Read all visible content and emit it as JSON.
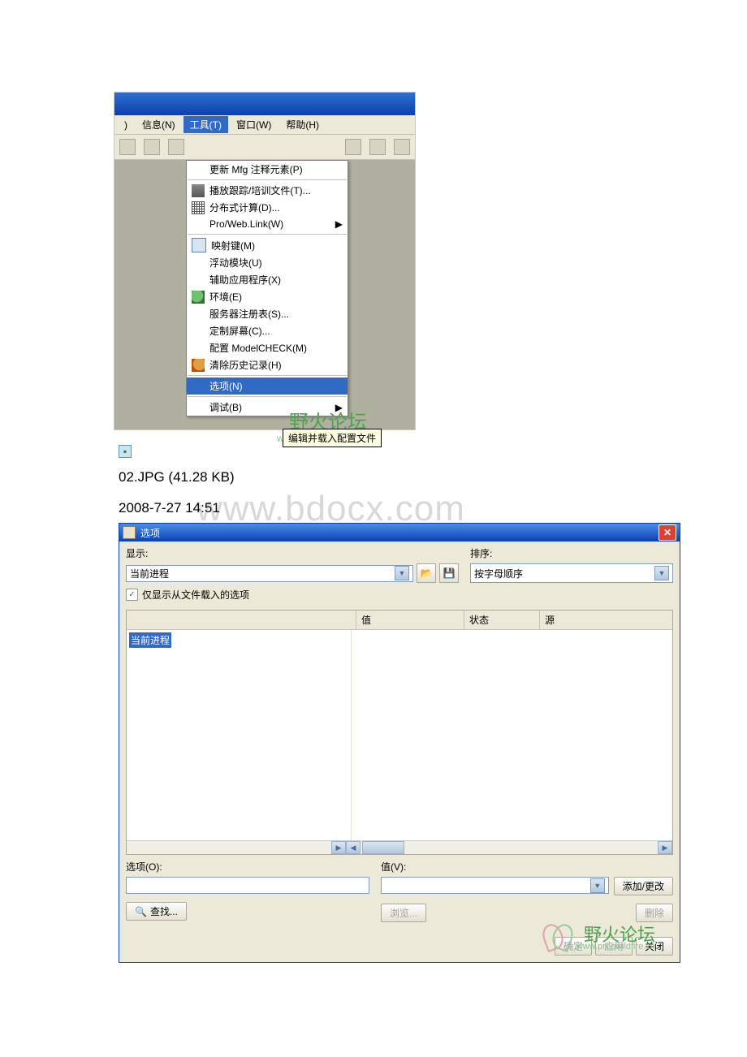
{
  "shot1": {
    "menubar": {
      "info": "信息(N)",
      "tools": "工具(T)",
      "window": "窗口(W)",
      "help": "帮助(H)"
    },
    "dropdown": {
      "update_mfg": "更新 Mfg 注释元素(P)",
      "play_trail": "播放跟踪/培训文件(T)...",
      "dist_comp": "分布式计算(D)...",
      "proweblink": "Pro/Web.Link(W)",
      "mapkeys": "映射键(M)",
      "float_mod": "浮动模块(U)",
      "aux_app": "辅助应用程序(X)",
      "environment": "环境(E)",
      "server_reg": "服务器注册表(S)...",
      "custom_screen": "定制屏幕(C)...",
      "config_modelcheck": "配置 ModelCHECK(M)",
      "clear_history": "清除历史记录(H)",
      "options": "选项(N)",
      "debug": "调试(B)"
    },
    "tooltip": "编辑并载入配置文件",
    "watermark_a": "野火论坛",
    "watermark_b": "www.proewildfire.cn"
  },
  "caption": "02.JPG (41.28 KB)",
  "timestamp": "2008-7-27 14:51",
  "big_watermark": "www.bdocx.com",
  "shot2": {
    "title": "选项",
    "display_label": "显示:",
    "display_value": "当前进程",
    "sort_label": "排序:",
    "sort_value": "按字母顺序",
    "checkbox": "仅显示从文件载入的选项",
    "table": {
      "col_name": "",
      "col_value": "值",
      "col_status": "状态",
      "col_source": "源",
      "item": "当前进程"
    },
    "option_label": "选项(O):",
    "value_label": "值(V):",
    "add_change": "添加/更改",
    "find": "查找...",
    "browse": "浏览...",
    "delete": "删除",
    "ok": "确定",
    "apply": "应用",
    "close": "关闭",
    "watermark_a": "野火论坛",
    "watermark_b": "www.proewildfire.cn"
  }
}
